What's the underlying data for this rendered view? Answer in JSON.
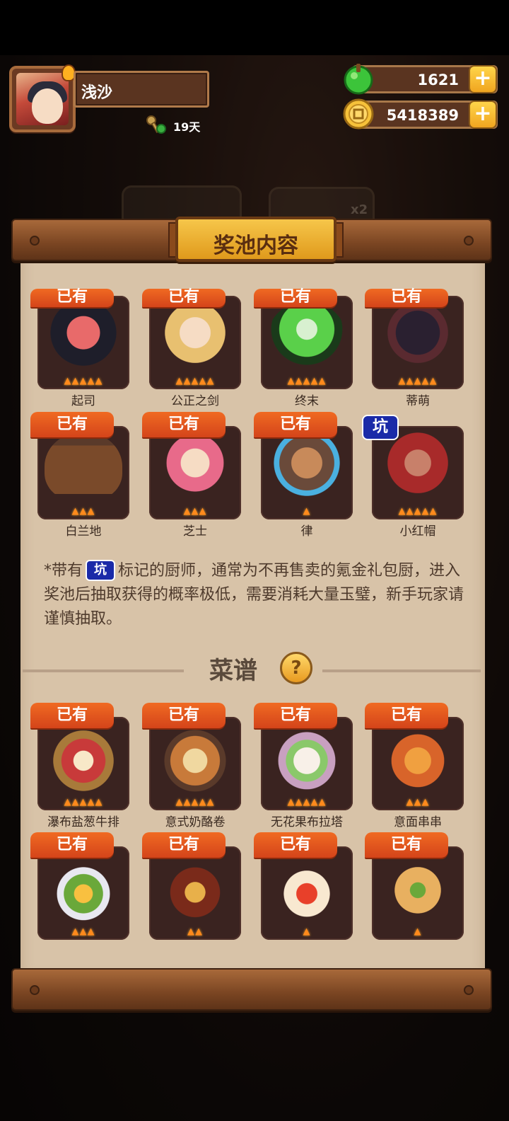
{
  "player": {
    "name": "浅沙",
    "days": "19天"
  },
  "resources": {
    "jade": "1621",
    "coins": "5418389"
  },
  "panel": {
    "title": "奖池内容"
  },
  "chefs": [
    {
      "name": "起司",
      "badge": "已有",
      "flames": 5
    },
    {
      "name": "公正之剑",
      "badge": "已有",
      "flames": 5
    },
    {
      "name": "终末",
      "badge": "已有",
      "flames": 5
    },
    {
      "name": "蒂萌",
      "badge": "已有",
      "flames": 5
    },
    {
      "name": "白兰地",
      "badge": "已有",
      "flames": 3
    },
    {
      "name": "芝士",
      "badge": "已有",
      "flames": 3
    },
    {
      "name": "律",
      "badge": "已有",
      "flames": 1
    },
    {
      "name": "小红帽",
      "badge": "坑",
      "flames": 5
    }
  ],
  "note": {
    "prefix": "*带有",
    "pit_label": "坑",
    "text": "标记的厨师，通常为不再售卖的氪金礼包厨，进入奖池后抽取获得的概率极低，需要消耗大量玉璧，新手玩家请谨慎抽取。"
  },
  "recipes_section": {
    "title": "菜谱",
    "help_icon": "?"
  },
  "recipes": [
    {
      "name": "瀑布盐葱牛排",
      "badge": "已有",
      "flames": 5
    },
    {
      "name": "意式奶酪卷",
      "badge": "已有",
      "flames": 5
    },
    {
      "name": "无花果布拉塔",
      "badge": "已有",
      "flames": 5
    },
    {
      "name": "意面串串",
      "badge": "已有",
      "flames": 3
    },
    {
      "name": "",
      "badge": "已有",
      "flames": 3
    },
    {
      "name": "",
      "badge": "已有",
      "flames": 2
    },
    {
      "name": "",
      "badge": "已有",
      "flames": 1
    },
    {
      "name": "",
      "badge": "已有",
      "flames": 1
    }
  ],
  "icons": {
    "plus": "+",
    "flame": "flame-icon",
    "jade": "jade-icon",
    "coin": "coin-icon"
  }
}
